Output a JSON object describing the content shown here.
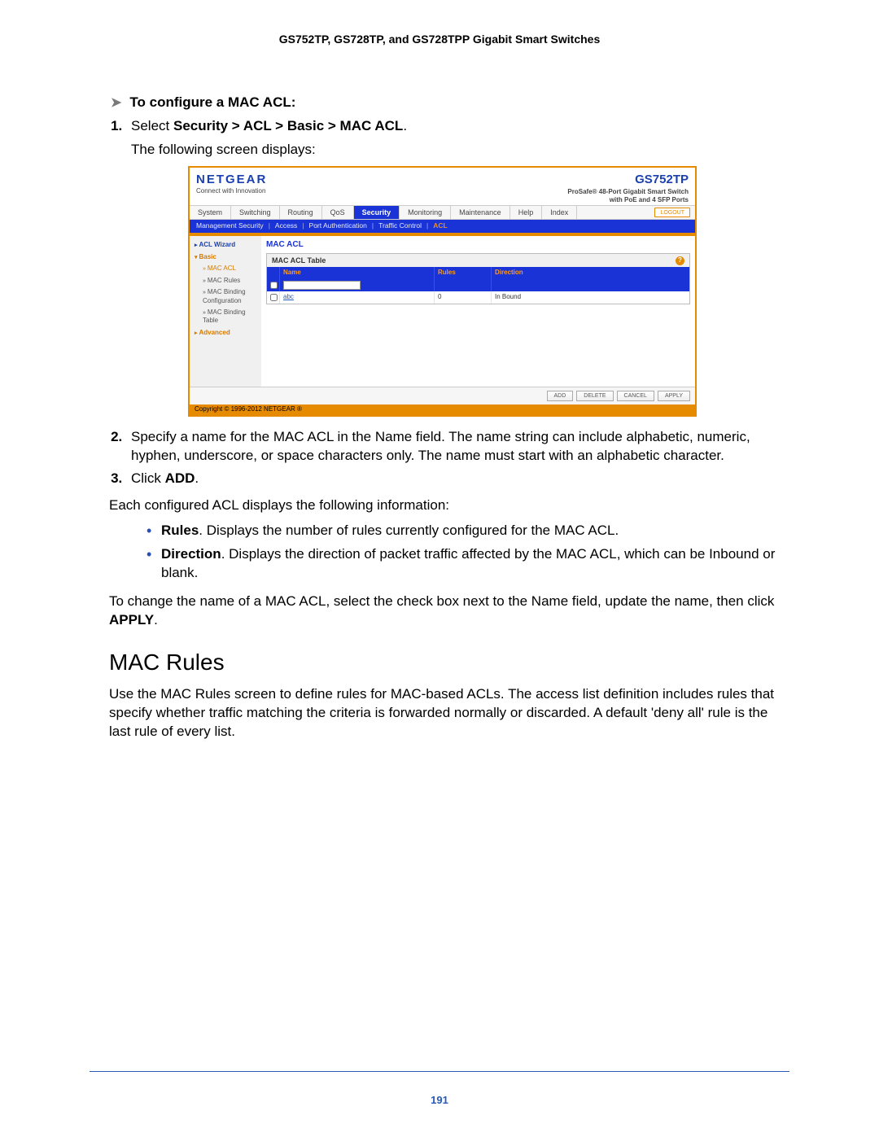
{
  "doc": {
    "header": "GS752TP, GS728TP, and GS728TPP Gigabit Smart Switches",
    "page_number": "191"
  },
  "instructions": {
    "lead": "To configure a MAC ACL:",
    "step1_prefix": "Select ",
    "step1_bold": "Security > ACL > Basic > MAC ACL",
    "step1_suffix": ".",
    "step1_sub": "The following screen displays:",
    "step2": "Specify a name for the MAC ACL in the Name field. The name string can include alphabetic, numeric, hyphen, underscore, or space characters only. The name must start with an alphabetic character.",
    "step3_prefix": "Click ",
    "step3_bold": "ADD",
    "step3_suffix": "."
  },
  "after_steps": "Each configured ACL displays the following information:",
  "bullets": {
    "rules_label": "Rules",
    "rules_text": ". Displays the number of rules currently configured for the MAC ACL.",
    "dir_label": "Direction",
    "dir_text": ". Displays the direction of packet traffic affected by the MAC ACL, which can be Inbound or blank."
  },
  "change_para_1": "To change the name of a MAC ACL, select the check box next to the Name field, update the name, then click ",
  "change_bold": "APPLY",
  "change_para_2": ".",
  "section2_title": "MAC Rules",
  "section2_body": "Use the MAC Rules screen to define rules for MAC-based ACLs. The access list definition includes rules that specify whether traffic matching the criteria is forwarded normally or discarded. A default 'deny all' rule is the last rule of every list.",
  "screenshot": {
    "brand": "NETGEAR",
    "brand_tag": "Connect with Innovation",
    "model": "GS752TP",
    "model_desc1": "ProSafe® 48-Port Gigabit Smart Switch",
    "model_desc2": "with PoE and 4 SFP Ports",
    "main_tabs": {
      "system": "System",
      "switching": "Switching",
      "routing": "Routing",
      "qos": "QoS",
      "security": "Security",
      "monitoring": "Monitoring",
      "maintenance": "Maintenance",
      "help": "Help",
      "index": "Index",
      "logout": "LOGOUT"
    },
    "sub_tabs": {
      "mgmt": "Management Security",
      "access": "Access",
      "portauth": "Port Authentication",
      "traffic": "Traffic Control",
      "acl": "ACL"
    },
    "side": {
      "wizard": "ACL Wizard",
      "basic": "Basic",
      "macacl": "MAC ACL",
      "macrules": "MAC Rules",
      "macbindcfg": "MAC Binding Configuration",
      "macbindtbl": "MAC Binding Table",
      "advanced": "Advanced"
    },
    "pane_title": "MAC ACL",
    "table_caption": "MAC ACL Table",
    "headers": {
      "name": "Name",
      "rules": "Rules",
      "direction": "Direction"
    },
    "row": {
      "name": "abc",
      "rules": "0",
      "direction": "In Bound"
    },
    "buttons": {
      "add": "ADD",
      "delete": "DELETE",
      "cancel": "CANCEL",
      "apply": "APPLY"
    },
    "copyright": "Copyright © 1996-2012 NETGEAR ®"
  }
}
